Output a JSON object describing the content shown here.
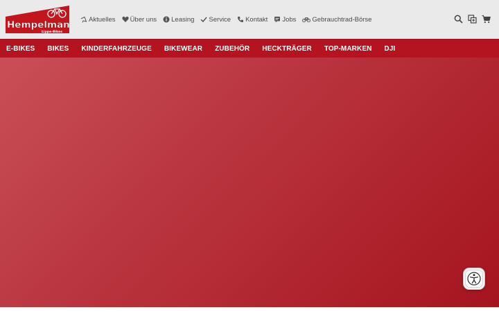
{
  "header": {
    "logo": {
      "text": "Hempelmann",
      "subtext": "Lippe-Bikes",
      "color": "#c4151c"
    },
    "nav": [
      {
        "label": "Aktuelles",
        "icon": "megaphone-icon"
      },
      {
        "label": "Über uns",
        "icon": "heart-icon"
      },
      {
        "label": "Leasing",
        "icon": "info-icon"
      },
      {
        "label": "Service",
        "icon": "checkmark-icon"
      },
      {
        "label": "Kontakt",
        "icon": "phone-icon"
      },
      {
        "label": "Jobs",
        "icon": "jobs-icon"
      },
      {
        "label": "Gebrauchtrad-Börse",
        "icon": "bicycle-icon"
      }
    ],
    "tools": [
      "search-icon",
      "compare-icon",
      "cart-icon"
    ]
  },
  "categories": [
    "E-BIKES",
    "BIKES",
    "KINDERFAHRZEUGE",
    "BIKEWEAR",
    "ZUBEHÖR",
    "HECKTRÄGER",
    "TOP-MARKEN",
    "DJI"
  ],
  "colors": {
    "accent": "#b3141f",
    "hero_start": "#c94f57",
    "hero_end": "#a5141e",
    "topbar": "#eaeaea"
  },
  "accessibility": {
    "icon": "accessibility-icon"
  }
}
